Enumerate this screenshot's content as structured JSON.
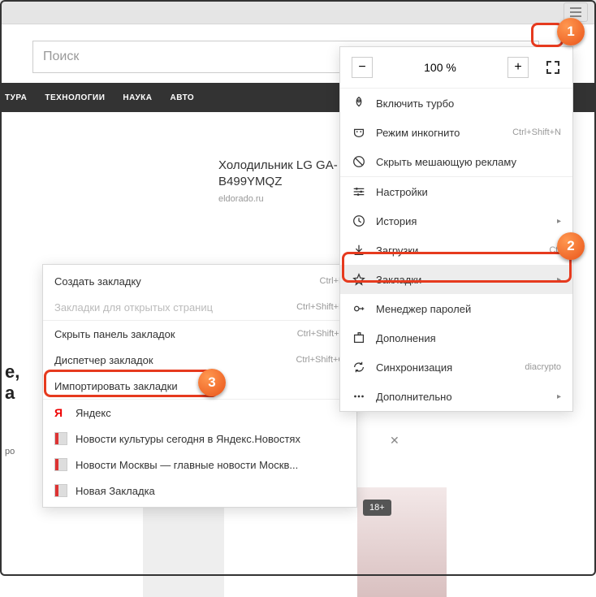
{
  "titlebar": {},
  "page": {
    "search_placeholder": "Поиск",
    "nav": [
      "ТУРА",
      "ТЕХНОЛОГИИ",
      "НАУКА",
      "АВТО"
    ],
    "card_title1": "Холодильник LG GA-",
    "card_title2": "B499YMQZ",
    "card_domain": "eldorado.ru",
    "text_frag1": "е,",
    "text_frag2": "а",
    "text_frag3": "ро",
    "badge18": "18+"
  },
  "menu": {
    "zoom_minus": "−",
    "zoom_text": "100 %",
    "zoom_plus": "+",
    "items": [
      {
        "icon": "rocket",
        "label": "Включить турбо"
      },
      {
        "icon": "mask",
        "label": "Режим инкогнито",
        "shortcut": "Ctrl+Shift+N"
      },
      {
        "icon": "block",
        "label": "Скрыть мешающую рекламу"
      }
    ],
    "items2": [
      {
        "icon": "sliders",
        "label": "Настройки"
      },
      {
        "icon": "history",
        "label": "История",
        "arrow": true
      },
      {
        "icon": "download",
        "label": "Загрузки",
        "shortcut": "Ctr"
      },
      {
        "icon": "star",
        "label": "Закладки",
        "arrow": true,
        "highlight": true
      },
      {
        "icon": "key",
        "label": "Менеджер паролей"
      },
      {
        "icon": "puzzle",
        "label": "Дополнения"
      },
      {
        "icon": "sync",
        "label": "Синхронизация",
        "shortcut": "diacrypto"
      },
      {
        "icon": "dots",
        "label": "Дополнительно",
        "arrow": true
      }
    ]
  },
  "submenu": {
    "items": [
      {
        "label": "Создать закладку",
        "shortcut": "Ctrl+D"
      },
      {
        "label": "Закладки для открытых страниц",
        "shortcut": "Ctrl+Shift+D",
        "disabled": true
      },
      {
        "sep": true
      },
      {
        "label": "Скрыть панель закладок",
        "shortcut": "Ctrl+Shift+B"
      },
      {
        "label": "Диспетчер закладок",
        "shortcut": "Ctrl+Shift+O"
      },
      {
        "label": "Импортировать закладки"
      },
      {
        "sep": true
      },
      {
        "fav": "y",
        "label": "Яндекс"
      },
      {
        "fav": "news",
        "label": "Новости культуры сегодня в Яндекс.Новостях"
      },
      {
        "fav": "news",
        "label": "Новости Москвы — главные новости Москв..."
      },
      {
        "fav": "news",
        "label": "Новая Закладка"
      }
    ]
  },
  "callouts": {
    "c1": "1",
    "c2": "2",
    "c3": "3"
  }
}
